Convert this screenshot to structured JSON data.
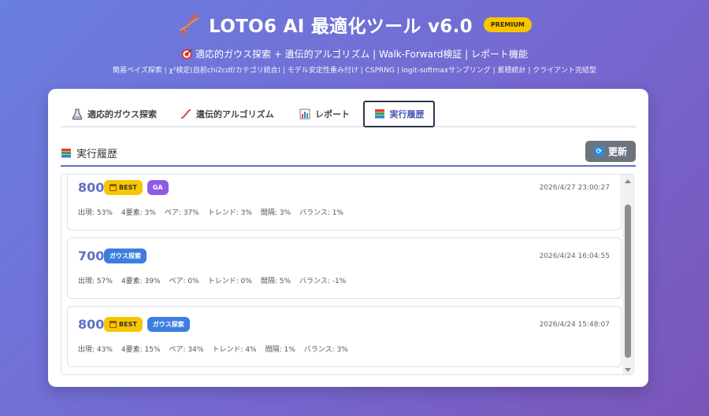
{
  "header": {
    "title": "LOTO6 AI 最適化ツール v6.0",
    "badge": "PREMIUM",
    "subtitle": "適応的ガウス探索 + 遺伝的アルゴリズム | Walk-Forward検証 | レポート機能",
    "features": "簡易ベイズ探索 | χ²検定(自前chi2cdf/カテゴリ統合) | モデル安定性重み付け | CSPRNG | logit-softmaxサンプリング | 累積統計 | クライアント完結型"
  },
  "tabs": [
    {
      "label": "適応的ガウス探索",
      "icon": "flask-icon"
    },
    {
      "label": "遺伝的アルゴリズム",
      "icon": "dna-icon"
    },
    {
      "label": "レポート",
      "icon": "bar-chart-icon"
    },
    {
      "label": "実行履歴",
      "icon": "books-icon",
      "active": true
    }
  ],
  "section": {
    "title": "実行履歴",
    "refresh_label": "更新"
  },
  "history": [
    {
      "score": "800",
      "badges": [
        {
          "type": "best",
          "label": "BEST"
        },
        {
          "type": "ga",
          "label": "GA"
        }
      ],
      "date": "2026/4/27 23:00:27",
      "stats": [
        "出現: 53%",
        "4要素: 3%",
        "ペア: 37%",
        "トレンド: 3%",
        "間隔: 3%",
        "バランス: 1%"
      ]
    },
    {
      "score": "700",
      "badges": [
        {
          "type": "gauss",
          "label": "ガウス探索"
        }
      ],
      "date": "2026/4/24 16:04:55",
      "stats": [
        "出現: 57%",
        "4要素: 39%",
        "ペア: 0%",
        "トレンド: 0%",
        "間隔: 5%",
        "バランス: -1%"
      ]
    },
    {
      "score": "800",
      "badges": [
        {
          "type": "best",
          "label": "BEST"
        },
        {
          "type": "gauss",
          "label": "ガウス探索"
        }
      ],
      "date": "2026/4/24 15:48:07",
      "stats": [
        "出現: 43%",
        "4要素: 15%",
        "ペア: 34%",
        "トレンド: 4%",
        "間隔: 1%",
        "バランス: 3%"
      ]
    }
  ],
  "colors": {
    "accent": "#6070c8",
    "best": "#f7c600",
    "ga": "#8e5be6",
    "gauss": "#3b7ee0",
    "refresh": "#6c757d"
  }
}
